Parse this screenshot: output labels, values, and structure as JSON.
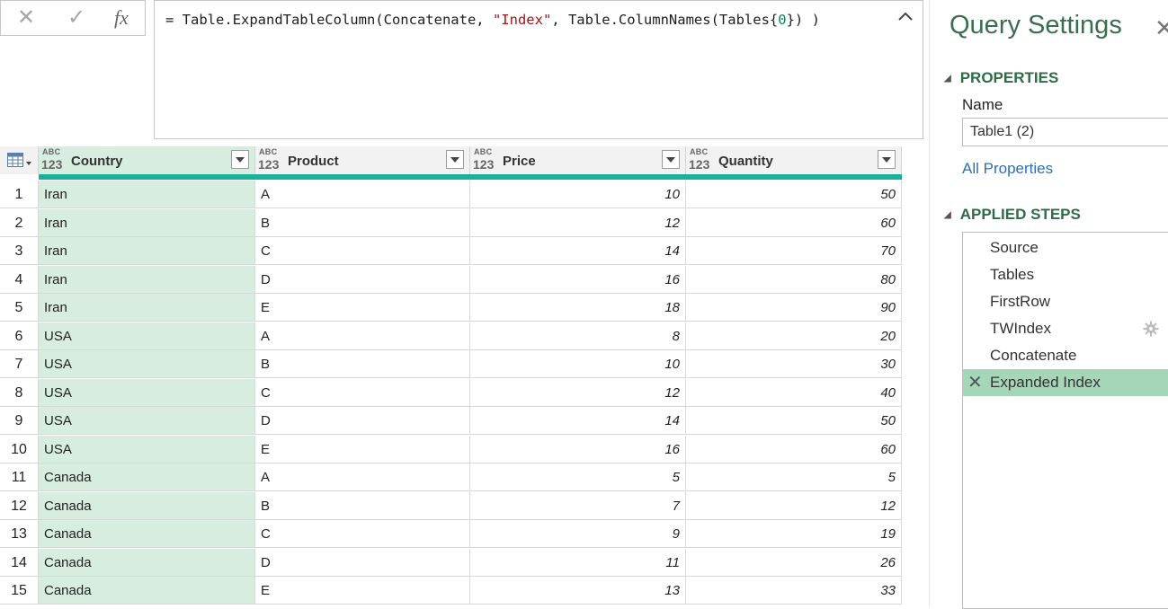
{
  "formula_bar": {
    "cancel_icon": "x-icon",
    "commit_icon": "check-icon",
    "fx_label": "fx",
    "formula_parts": {
      "prefix": "= Table.ExpandTableColumn(Concatenate, ",
      "string": "\"Index\"",
      "middle": ", Table.ColumnNames(Tables{",
      "number": "0",
      "suffix": "}) )"
    }
  },
  "table": {
    "columns": [
      {
        "type_top": "ABC",
        "type_bottom": "123",
        "label": "Country"
      },
      {
        "type_top": "ABC",
        "type_bottom": "123",
        "label": "Product"
      },
      {
        "type_top": "ABC",
        "type_bottom": "123",
        "label": "Price"
      },
      {
        "type_top": "ABC",
        "type_bottom": "123",
        "label": "Quantity"
      }
    ],
    "rows": [
      [
        "1",
        "Iran",
        "A",
        "10",
        "50"
      ],
      [
        "2",
        "Iran",
        "B",
        "12",
        "60"
      ],
      [
        "3",
        "Iran",
        "C",
        "14",
        "70"
      ],
      [
        "4",
        "Iran",
        "D",
        "16",
        "80"
      ],
      [
        "5",
        "Iran",
        "E",
        "18",
        "90"
      ],
      [
        "6",
        "USA",
        "A",
        "8",
        "20"
      ],
      [
        "7",
        "USA",
        "B",
        "10",
        "30"
      ],
      [
        "8",
        "USA",
        "C",
        "12",
        "40"
      ],
      [
        "9",
        "USA",
        "D",
        "14",
        "50"
      ],
      [
        "10",
        "USA",
        "E",
        "16",
        "60"
      ],
      [
        "11",
        "Canada",
        "A",
        "5",
        "5"
      ],
      [
        "12",
        "Canada",
        "B",
        "7",
        "12"
      ],
      [
        "13",
        "Canada",
        "C",
        "9",
        "19"
      ],
      [
        "14",
        "Canada",
        "D",
        "11",
        "26"
      ],
      [
        "15",
        "Canada",
        "E",
        "13",
        "33"
      ]
    ]
  },
  "query_settings": {
    "title": "Query Settings",
    "close_glyph": "✕",
    "properties_header": "PROPERTIES",
    "name_label": "Name",
    "name_value": "Table1 (2)",
    "all_properties_link": "All Properties",
    "applied_steps_header": "APPLIED STEPS",
    "steps": [
      "Source",
      "Tables",
      "FirstRow",
      "TWIndex",
      "Concatenate",
      "Expanded Index"
    ],
    "selected_step": "Expanded Index",
    "step_with_gear": "TWIndex"
  },
  "colors": {
    "accent_green": "#2e6b46",
    "teal_bar": "#1bb09a",
    "selected_step": "#a5d6b7",
    "country_column": "#d7ede0"
  }
}
